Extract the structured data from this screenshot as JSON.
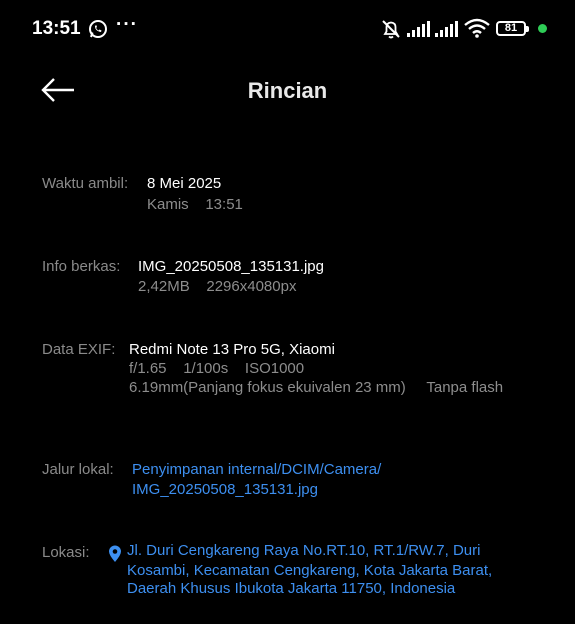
{
  "status_bar": {
    "time": "13:51",
    "more_glyph": "···",
    "battery": "81",
    "icons": [
      "whatsapp-icon",
      "more-icon",
      "mute-icon",
      "signal-icon",
      "signal-icon",
      "wifi-icon",
      "battery-icon",
      "dot-icon"
    ],
    "colors": {
      "dot": "#2ecc56"
    }
  },
  "header": {
    "title": "Rincian",
    "back_icon": "arrow-left-icon"
  },
  "details": {
    "taken": {
      "label": "Waktu ambil:",
      "date": "8 Mei 2025",
      "day_time": "Kamis    13:51"
    },
    "file": {
      "label": "Info berkas:",
      "name": "IMG_20250508_135131.jpg",
      "meta": "2,42MB    2296x4080px"
    },
    "exif": {
      "label": "Data EXIF:",
      "device": "Redmi Note 13 Pro 5G, Xiaomi",
      "settings": "f/1.65    1/100s    ISO1000",
      "focal": "6.19mm(Panjang fokus ekuivalen 23 mm)     Tanpa flash"
    },
    "path": {
      "label": "Jalur lokal:",
      "line1": "Penyimpanan internal/DCIM/Camera/",
      "line2": "IMG_20250508_135131.jpg"
    },
    "location": {
      "label": "Lokasi:",
      "icon": "location-pin-icon",
      "line1": "Jl. Duri Cengkareng Raya No.RT.10, RT.1/RW.7, Duri",
      "line2": "Kosambi, Kecamatan Cengkareng, Kota Jakarta Barat,",
      "line3": "Daerah Khusus Ibukota Jakarta 11750, Indonesia"
    }
  },
  "colors": {
    "background": "#000000",
    "label": "#8a8a8a",
    "link": "#3d8ff0"
  }
}
